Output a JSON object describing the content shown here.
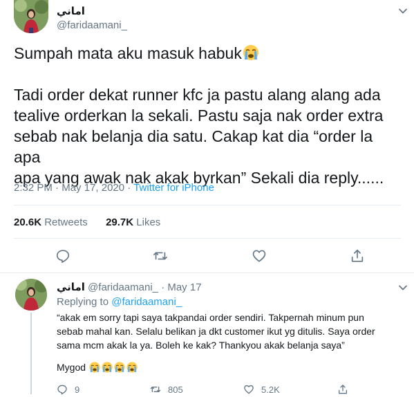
{
  "main_tweet": {
    "display_name": "اماني",
    "handle": "@faridaamani_",
    "line1": "Sumpah mata aku masuk habuk",
    "line2": "Tadi order dekat runner kfc ja pastu alang alang ada",
    "line3": "tealive orderkan la sekali. Pastu saja nak order extra",
    "line4": "sebab nak belanja dia satu. Cakap kat dia “order la apa",
    "line5": "apa yang awak nak akak byrkan” Sekali dia reply......",
    "time": "2:32 PM",
    "separator": " · ",
    "date": "May 17, 2020",
    "source": "Twitter for iPhone",
    "retweets_count": "20.6K",
    "retweets_label": "Retweets",
    "likes_count": "29.7K",
    "likes_label": "Likes",
    "emoji_icon": "crying-face-emoji"
  },
  "reply_tweet": {
    "display_name": "اماني",
    "handle": "@faridaamani_",
    "date": "May 17",
    "replying_to_label": "Replying to",
    "replying_to_handle": "@faridaamani_",
    "text_line1": "“akak em sorry tapi saya takpandai order sendiri. Takpernah minum pun",
    "text_line2": "sebab mahal kan. Selalu belikan ja dkt customer ikut yg ditulis. Saya order",
    "text_line3": "sama mcm akak la ya. Boleh ke kak? Thankyou akak belanja saya”",
    "mygod": "Mygod",
    "reply_count": "9",
    "retweet_count": "805",
    "like_count": "5.2K"
  },
  "colors": {
    "text": "#14171a",
    "secondary": "#657786",
    "link": "#1da1f2",
    "border": "#e6ecf0"
  }
}
